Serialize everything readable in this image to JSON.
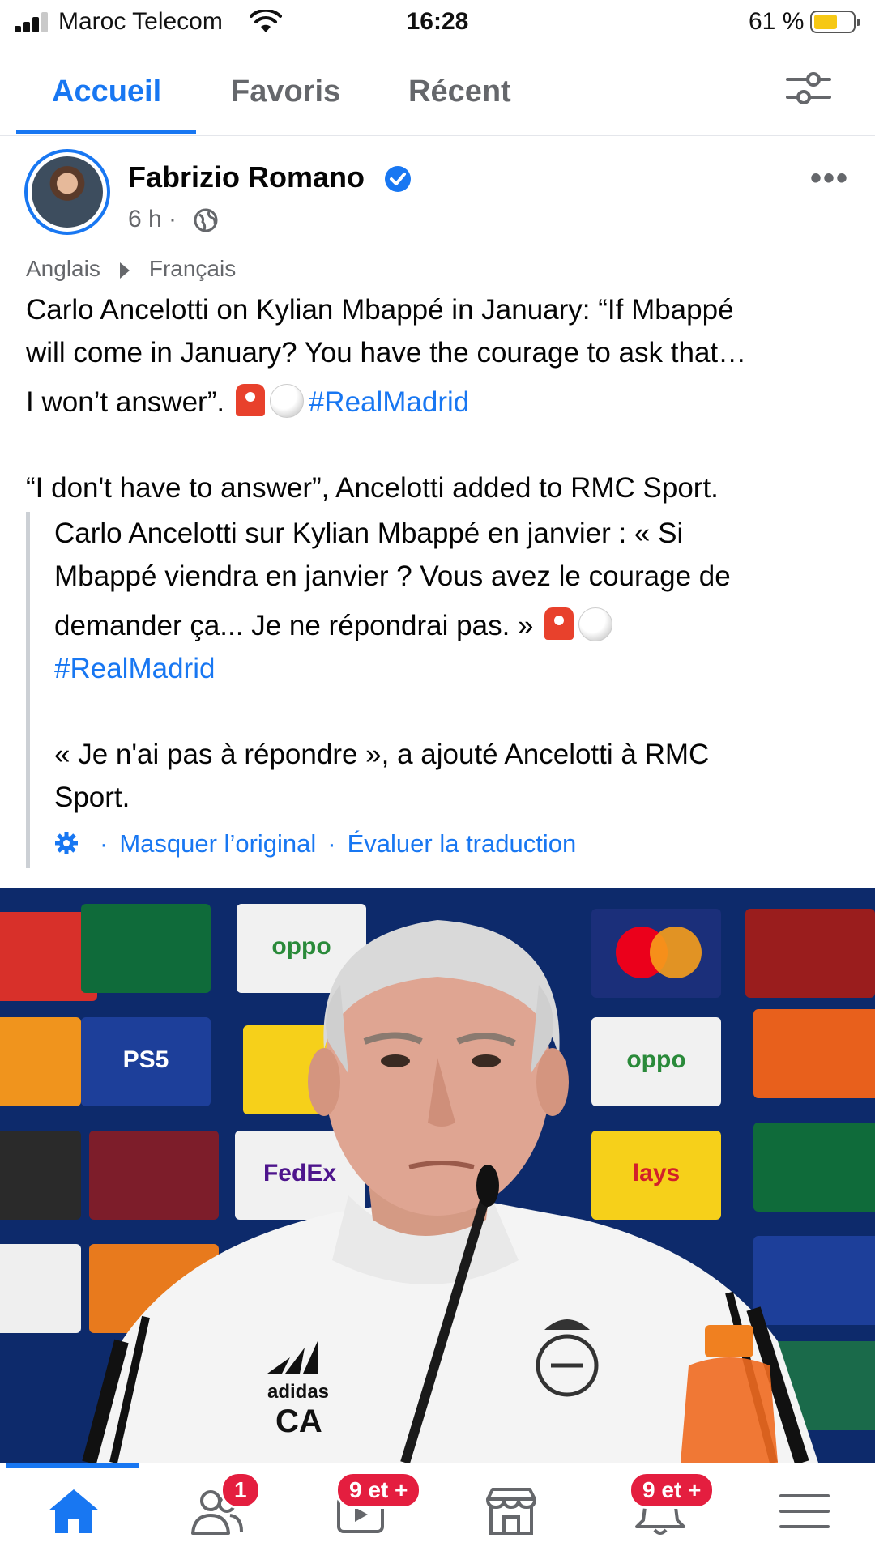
{
  "status_bar": {
    "carrier": "Maroc Telecom",
    "time": "16:28",
    "battery": "61 %",
    "battery_level": 0.61
  },
  "tabs": {
    "items": [
      {
        "label": "Accueil",
        "active": true
      },
      {
        "label": "Favoris",
        "active": false
      },
      {
        "label": "Récent",
        "active": false
      }
    ]
  },
  "post": {
    "author": "Fabrizio Romano",
    "time": "6 h ·",
    "translation": {
      "from": "Anglais",
      "to": "Français"
    },
    "original_line1": "Carlo Ancelotti on Kylian Mbappé in January: “If Mbappé",
    "original_line2": "will come in January? You have the courage to ask that…",
    "original_line3": "I won’t answer”.",
    "hashtag": "#RealMadrid",
    "original_line4": "“I don't have to answer”, Ancelotti added to RMC Sport.",
    "translated_line1": "Carlo Ancelotti sur Kylian Mbappé en janvier : « Si",
    "translated_line2": "Mbappé viendra en janvier ? Vous avez le courage de",
    "translated_line3": "demander ça... Je ne répondrai pas. »",
    "translated_line4": "« Je n'ai pas à répondre », a ajouté Ancelotti à RMC",
    "translated_line5": "Sport.",
    "hide_original": "Masquer l’original",
    "rate_translation": "Évaluer la traduction",
    "photo_texts": [
      "oppo",
      "lays",
      "FedEx",
      "PS5",
      "adidas",
      "CA"
    ]
  },
  "bottom_nav": {
    "friends_badge": "1",
    "watch_badge": "9 et +",
    "notifications_badge": "9 et +"
  },
  "colors": {
    "accent": "#1877f2",
    "badge": "#e41e3f"
  }
}
